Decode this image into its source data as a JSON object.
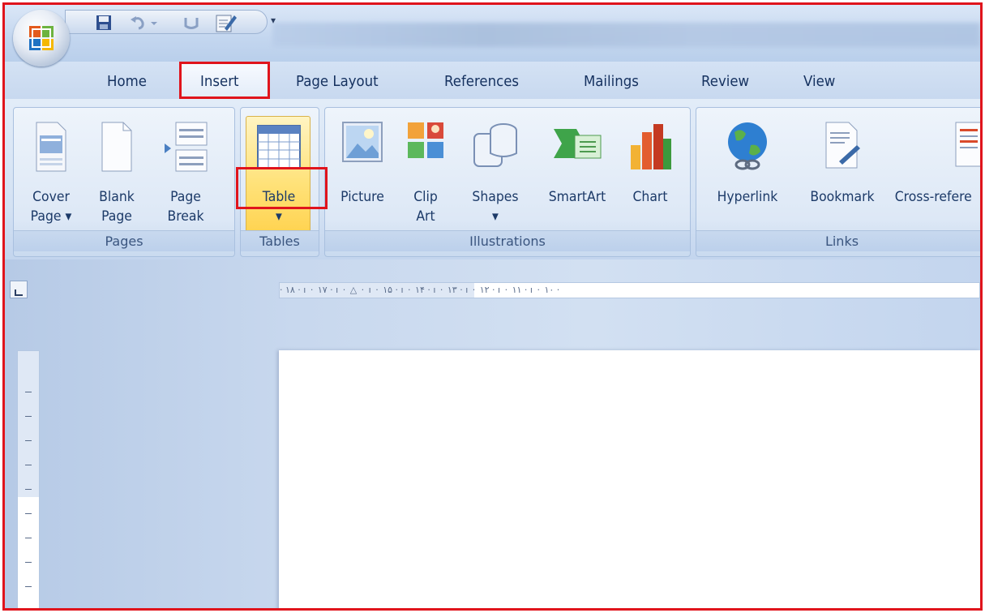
{
  "tabs": [
    "Home",
    "Insert",
    "Page Layout",
    "References",
    "Mailings",
    "Review",
    "View"
  ],
  "groups": {
    "pages": {
      "label": "Pages",
      "buttons": [
        "Cover\nPage ▾",
        "Blank\nPage",
        "Page\nBreak"
      ]
    },
    "tables": {
      "label": "Tables",
      "buttons": [
        "Table\n▾"
      ]
    },
    "illustrations": {
      "label": "Illustrations",
      "buttons": [
        "Picture",
        "Clip\nArt",
        "Shapes\n▾",
        "SmartArt",
        "Chart"
      ]
    },
    "links": {
      "label": "Links",
      "buttons": [
        "Hyperlink",
        "Bookmark",
        "Cross-refere"
      ]
    }
  },
  "ruler": {
    "horizontal": "· ۱۸ · ı · ۱۷ · ı · △ · ı · ۱۵ · ı · ۱۴ · ı · ۱۳ · ı · ۱۲ · ı · ۱۱ · ı · ۱۰ ·"
  },
  "icons": {
    "office": "office-logo-icon",
    "qat": [
      "save-icon",
      "undo-icon",
      "redo-icon",
      "edit-icon"
    ]
  },
  "colors": {
    "highlight": "#e0141c",
    "table_selected": "#ffe27a",
    "tab_text": "#15315f"
  }
}
